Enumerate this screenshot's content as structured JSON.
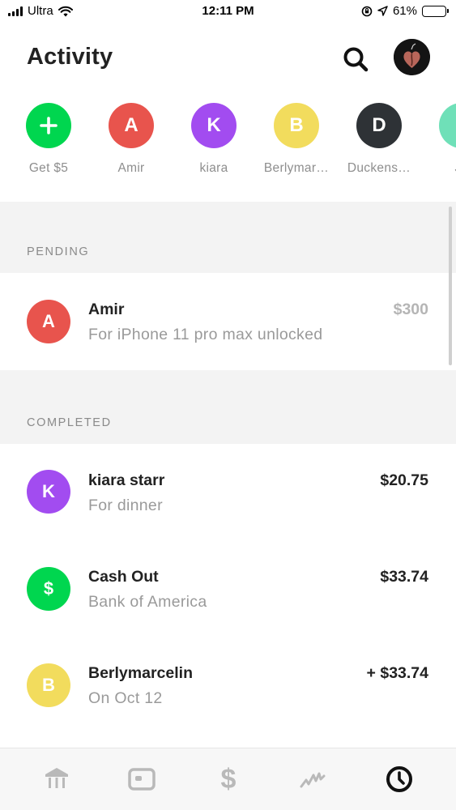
{
  "status_bar": {
    "carrier": "Ultra",
    "time": "12:11 PM",
    "battery_percent": "61%",
    "battery_level": 0.61,
    "icons": [
      "signal-icon",
      "wifi-icon",
      "orientation-lock-icon",
      "location-arrow-icon",
      "battery-icon"
    ]
  },
  "header": {
    "title": "Activity",
    "search_icon": "search-icon",
    "profile_icon": "profile-avatar"
  },
  "contacts": [
    {
      "initial": "+",
      "label": "Get $5",
      "color": "#00d64f"
    },
    {
      "initial": "A",
      "label": "Amir",
      "color": "#e8544d"
    },
    {
      "initial": "K",
      "label": "kiara",
      "color": "#a24cf0"
    },
    {
      "initial": "B",
      "label": "Berlymar…",
      "color": "#f2dc5d"
    },
    {
      "initial": "D",
      "label": "Duckens…",
      "color": "#2e3236"
    },
    {
      "initial": "",
      "label": "Ja",
      "color": "#6fe0b8"
    }
  ],
  "sections": {
    "pending_label": "PENDING",
    "completed_label": "COMPLETED"
  },
  "pending": [
    {
      "initial": "A",
      "name": "Amir",
      "note": "For iPhone 11 pro max unlocked",
      "amount": "$300",
      "color": "#e8544d"
    }
  ],
  "completed": [
    {
      "initial": "K",
      "name": "kiara starr",
      "note": "For dinner",
      "amount": "$20.75",
      "color": "#a24cf0"
    },
    {
      "initial": "$",
      "name": "Cash Out",
      "note": "Bank of America",
      "amount": "$33.74",
      "color": "#00d64f"
    },
    {
      "initial": "B",
      "name": "Berlymarcelin",
      "note": "On Oct 12",
      "amount": "+ $33.74",
      "color": "#f2dc5d"
    }
  ],
  "tab_bar": {
    "tabs": [
      "bank-icon",
      "card-icon",
      "dollar-icon",
      "investing-icon",
      "activity-clock-icon"
    ],
    "active": "activity-clock-icon"
  },
  "colors": {
    "accent_green": "#00d64f",
    "section_background": "#f3f3f3"
  }
}
